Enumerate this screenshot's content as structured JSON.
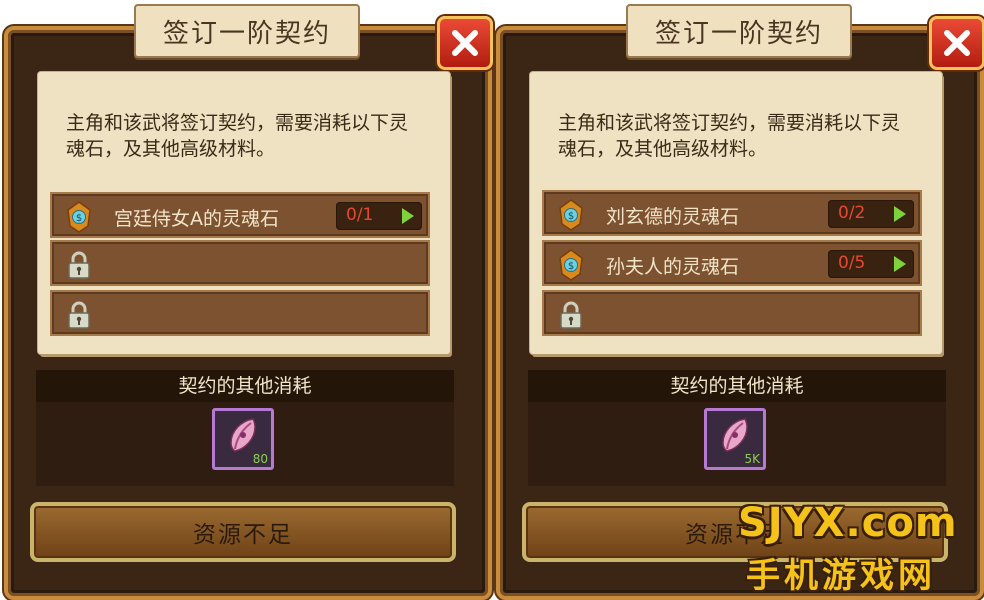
{
  "panels": [
    {
      "title": "签订一阶契约",
      "description": "主角和该武将签订契约，需要消耗以下灵魂石，及其他高级材料。",
      "slots": [
        {
          "type": "stone",
          "name": "宫廷侍女A的灵魂石",
          "count": "0/1"
        },
        {
          "type": "locked"
        },
        {
          "type": "locked"
        }
      ],
      "other_header": "契约的其他消耗",
      "item_amount": "80",
      "button_label": "资源不足"
    },
    {
      "title": "签订一阶契约",
      "description": "主角和该武将签订契约，需要消耗以下灵魂石，及其他高级材料。",
      "slots": [
        {
          "type": "stone",
          "name": "刘玄德的灵魂石",
          "count": "0/2"
        },
        {
          "type": "stone",
          "name": "孙夫人的灵魂石",
          "count": "0/5"
        },
        {
          "type": "locked"
        }
      ],
      "other_header": "契约的其他消耗",
      "item_amount": "5K",
      "button_label": "资源不足"
    }
  ],
  "watermark": {
    "top": "SJYX.com",
    "bottom": "手机游戏网"
  },
  "colors": {
    "count_text": "#e54a2e",
    "arrow": "#7ed23c",
    "item_border": "#b67ad2",
    "watermark": "#f5c21a"
  },
  "icons": {
    "close": "close-x-icon",
    "stone": "soul-stone-icon",
    "lock": "lock-icon",
    "item": "feather-gem-icon"
  }
}
